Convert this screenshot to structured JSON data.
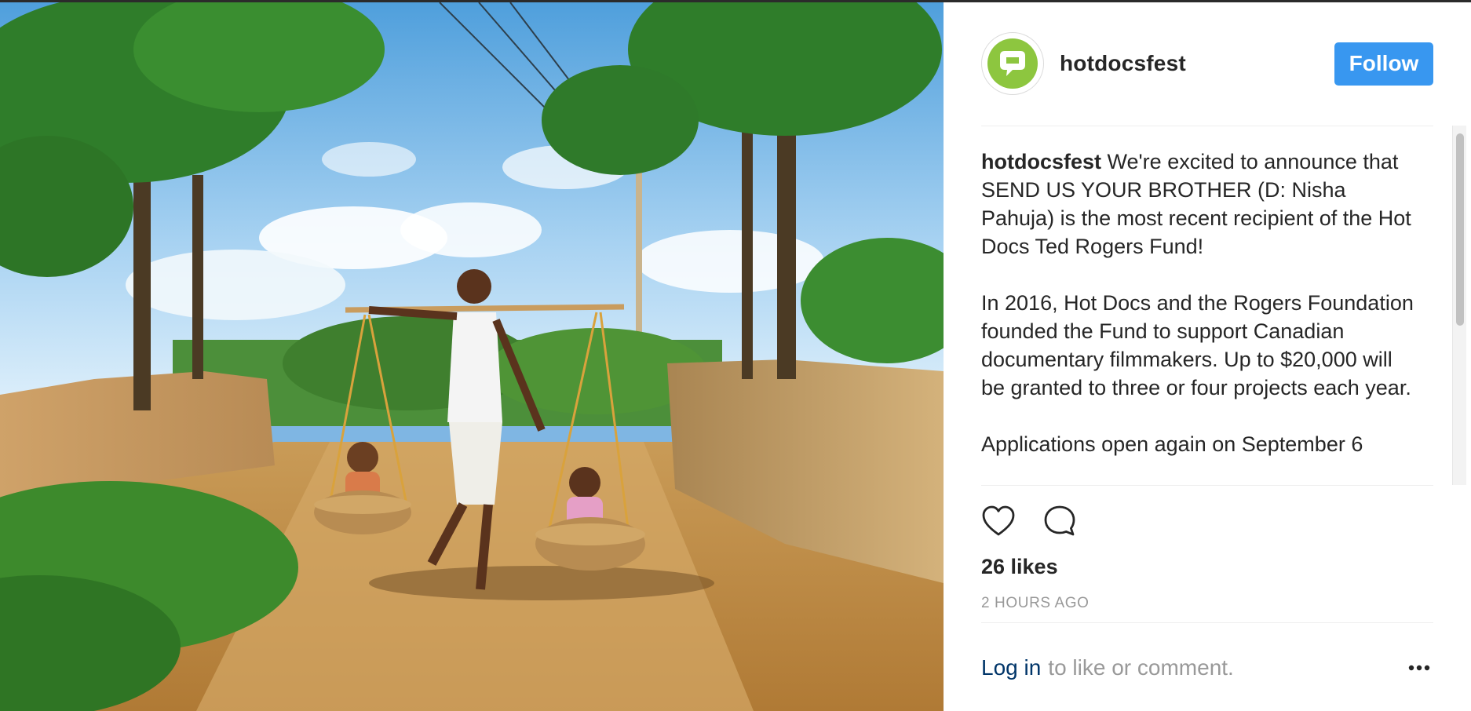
{
  "post": {
    "username": "hotdocsfest",
    "follow_label": "Follow",
    "caption_username": "hotdocsfest",
    "caption_text": " We're excited to announce that SEND US YOUR BROTHER (D: Nisha Pahuja) is the most recent recipient of the Hot Docs Ted Rogers Fund!\n\nIn 2016, Hot Docs and the Rogers Foundation founded the Fund to support Canadian documentary filmmakers. Up to $20,000 will be granted to three or four projects each year.\n\nApplications open again on September 6",
    "likes": "26 likes",
    "timestamp": "2 HOURS AGO",
    "login_link": "Log in",
    "login_rest": "to like or comment."
  },
  "icons": {
    "avatar": "speech-bubble-logo",
    "like": "heart-icon",
    "comment": "comment-icon",
    "more": "more-options-icon"
  },
  "colors": {
    "follow_button": "#3897f0",
    "brand_logo": "#8dc63f",
    "link": "#003569",
    "muted": "#999999",
    "text": "#262626"
  }
}
